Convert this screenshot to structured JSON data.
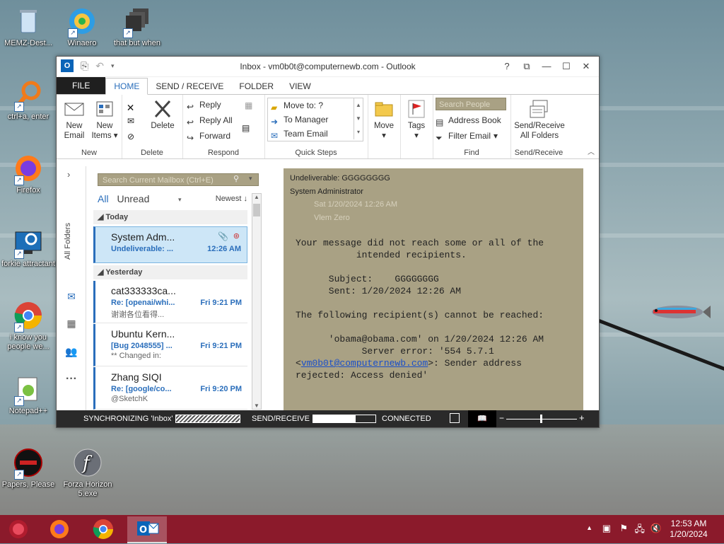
{
  "desktop": {
    "icons": [
      {
        "id": "recycle",
        "label": "MEMZ-Dest..."
      },
      {
        "id": "winaero",
        "label": "Winaero"
      },
      {
        "id": "thatbut",
        "label": "that but when"
      },
      {
        "id": "ctrl",
        "label": "ctrl+a, enter"
      },
      {
        "id": "firefox",
        "label": "Firefox"
      },
      {
        "id": "forkie",
        "label": "forkie attractant"
      },
      {
        "id": "chrome",
        "label": "i know you people we..."
      },
      {
        "id": "notepad",
        "label": "Notepad++"
      },
      {
        "id": "papers",
        "label": "Papers, Please"
      },
      {
        "id": "forza",
        "label": "Forza Horizon 5.exe"
      }
    ]
  },
  "window": {
    "title": "Inbox - vm0b0t@computernewb.com - Outlook",
    "controls": {
      "help": "?",
      "restore": "⧉",
      "maximize": "☐",
      "close": "✕"
    }
  },
  "ribbon": {
    "tabs": [
      "FILE",
      "HOME",
      "SEND / RECEIVE",
      "FOLDER",
      "VIEW"
    ],
    "groups": {
      "new": {
        "label": "New",
        "new_email": "New Email",
        "new_items": "New Items"
      },
      "delete": {
        "label": "Delete",
        "delete": "Delete"
      },
      "respond": {
        "label": "Respond",
        "reply": "Reply",
        "reply_all": "Reply All",
        "forward": "Forward"
      },
      "quick_steps": {
        "label": "Quick Steps",
        "items": [
          "Move to: ?",
          "To Manager",
          "Team Email"
        ]
      },
      "move": {
        "label": "Move"
      },
      "tags": {
        "label": "Tags"
      },
      "find": {
        "label": "Find",
        "search_people": "Search People",
        "address_book": "Address Book",
        "filter_email": "Filter Email"
      },
      "send_receive": {
        "label": "Send/Receive",
        "button": "Send/Receive All Folders"
      }
    }
  },
  "nav": {
    "all_folders": "All Folders"
  },
  "mail_list": {
    "search_placeholder": "Search Current Mailbox (Ctrl+E)",
    "filter_all": "All",
    "filter_unread": "Unread",
    "sort": "Newest",
    "groups": [
      {
        "header": "Today",
        "items": [
          {
            "from": "System Adm...",
            "subject": "Undeliverable: ...",
            "time": "12:26 AM",
            "preview": "",
            "selected": true
          }
        ]
      },
      {
        "header": "Yesterday",
        "items": [
          {
            "from": "cat333333ca...",
            "subject": "Re: [openai/whi...",
            "time": "Fri 9:21 PM",
            "preview": "谢谢各位看得..."
          },
          {
            "from": "Ubuntu Kern...",
            "subject": "[Bug 2048555] ...",
            "time": "Fri 9:21 PM",
            "preview": "** Changed in:"
          },
          {
            "from": "Zhang SIQI",
            "subject": "Re: [google/co...",
            "time": "Fri 9:20 PM",
            "preview": "@SketchK"
          }
        ]
      }
    ]
  },
  "reading_pane": {
    "subject": "Undeliverable: GGGGGGGG",
    "from": "System Administrator",
    "date": "Sat 1/20/2024 12:26 AM",
    "to": "Vlem Zero",
    "body_lines": [
      "Your message did not reach some or all of the",
      "           intended recipients.",
      "",
      "      Subject:    GGGGGGGG",
      "      Sent: 1/20/2024 12:26 AM",
      "",
      "The following recipient(s) cannot be reached:",
      "",
      "      'obama@obama.com' on 1/20/2024 12:26 AM",
      "            Server error: '554 5.7.1"
    ],
    "link_open": "<",
    "link": "vm0b0t@computernewb.com",
    "link_tail": ">: Sender address",
    "last_line": "rejected: Access denied'"
  },
  "status_bar": {
    "sync": "SYNCHRONIZING  'Inbox'",
    "send_receive": "SEND/RECEIVE",
    "send_receive_progress": 0.68,
    "connected": "CONNECTED"
  },
  "taskbar": {
    "time": "12:53 AM",
    "date": "1/20/2024"
  },
  "colors": {
    "accent": "#2a6ebb",
    "taskbar": "#8b1a2b",
    "reading_bg": "#a9a184"
  }
}
